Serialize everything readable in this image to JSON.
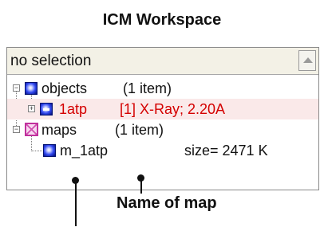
{
  "title": "ICM Workspace",
  "panel": {
    "header_text": "no selection",
    "tree": [
      {
        "name": "objects",
        "count": "(1 item)"
      },
      {
        "name": "1atp",
        "info": "[1] X-Ray; 2.20A"
      },
      {
        "name": "maps",
        "count": "(1 item)"
      },
      {
        "name": "m_1atp",
        "info": "size= 2471 K"
      }
    ]
  },
  "caption": "Name of map",
  "colors": {
    "selected_text": "#d40000",
    "icon_blue": "#3048f0",
    "map_icon": "#c0309c"
  }
}
